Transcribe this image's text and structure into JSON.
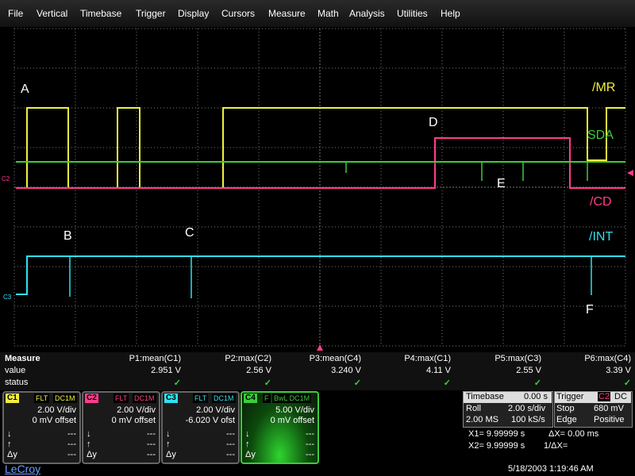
{
  "menu": [
    "File",
    "Vertical",
    "Timebase",
    "Trigger",
    "Display",
    "Cursors",
    "Measure",
    "Math",
    "Analysis",
    "Utilities",
    "Help"
  ],
  "colors": {
    "c1": "#f0f040",
    "c2": "#ff3c8c",
    "c3": "#2ee0f0",
    "c4": "#3ccc3c",
    "grid": "#777777",
    "check": "#3cd43c"
  },
  "traces": {
    "mr": "/MR",
    "sda": "SDA",
    "cd": "/CD",
    "int": "/INT"
  },
  "annotations": {
    "a": "A",
    "b": "B",
    "c": "C",
    "d": "D",
    "e": "E",
    "f": "F"
  },
  "markers": {
    "c2_left": "C2",
    "c3_left": "C3"
  },
  "measure": {
    "title": "Measure",
    "row_value": "value",
    "row_status": "status",
    "params": [
      {
        "name": "P1:mean(C1)",
        "value": "2.951 V"
      },
      {
        "name": "P2:max(C2)",
        "value": "2.56 V"
      },
      {
        "name": "P3:mean(C4)",
        "value": "3.240 V"
      },
      {
        "name": "P4:max(C1)",
        "value": "4.11 V"
      },
      {
        "name": "P5:max(C3)",
        "value": "2.55 V"
      },
      {
        "name": "P6:max(C4)",
        "value": "3.39 V"
      }
    ],
    "status_mark": "✓"
  },
  "channels": [
    {
      "tag": "C1",
      "flag1": "FLT",
      "flag2": "DC1M",
      "vdiv": "2.00 V/div",
      "offset": "0 mV offset"
    },
    {
      "tag": "C2",
      "flag1": "FLT",
      "flag2": "DC1M",
      "vdiv": "2.00 V/div",
      "offset": "0 mV offset"
    },
    {
      "tag": "C3",
      "flag1": "FLT",
      "flag2": "DC1M",
      "vdiv": "2.00 V/div",
      "offset": "-6.020 V ofst"
    },
    {
      "tag": "C4",
      "flag1": "F",
      "flag2": "BwL DC1M",
      "vdiv": "5.00 V/div",
      "offset": "0 mV offset"
    }
  ],
  "chan_rows": {
    "down": "↓",
    "up": "↑",
    "dy": "Δy",
    "dash": "---"
  },
  "timebase": {
    "title": "Timebase",
    "delay": "0.00 s",
    "mode": "Roll",
    "sdiv": "2.00 s/div",
    "samples": "2.00 MS",
    "rate": "100 kS/s"
  },
  "trigger": {
    "title": "Trigger",
    "src": "C2",
    "coupling": "DC",
    "mode": "Stop",
    "level": "680 mV",
    "type": "Edge",
    "slope": "Positive"
  },
  "cursors": {
    "x1": "X1= 9.99999 s",
    "dx": "ΔX= 0.00 ms",
    "x2": "X2= 9.99999 s",
    "invdx": "1/ΔX="
  },
  "footer": {
    "brand": "LeCroy",
    "datetime": "5/18/2003 1:19:46 AM"
  }
}
